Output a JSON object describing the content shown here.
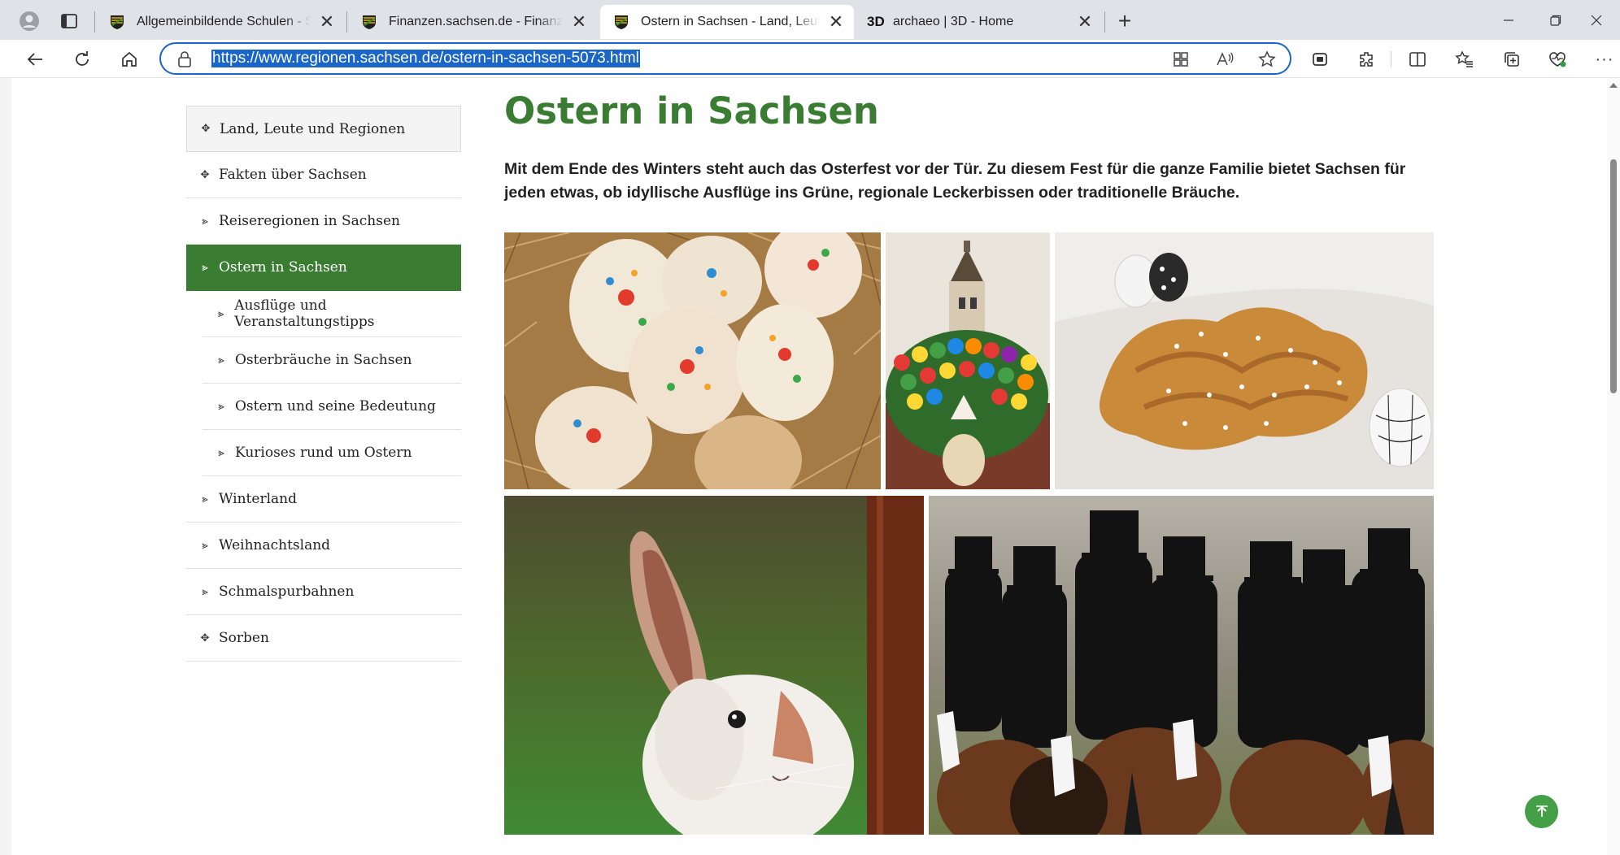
{
  "browser": {
    "tabs": [
      {
        "title": "Allgemeinbildende Schulen - Schulen in Sachsen",
        "favicon": "saxony-coat-of-arms-icon",
        "active": false
      },
      {
        "title": "Finanzen.sachsen.de - Finanzen - sachsen.de",
        "favicon": "saxony-coat-of-arms-icon",
        "active": false
      },
      {
        "title": "Ostern in Sachsen - Land, Leute und Regionen",
        "favicon": "saxony-coat-of-arms-icon",
        "active": true
      },
      {
        "title": "archaeo | 3D - Home",
        "favicon_text": "3D",
        "active": false
      }
    ],
    "url": "https://www.regionen.sachsen.de/ostern-in-sachsen-5073.html"
  },
  "sidenav": {
    "items": [
      {
        "label": "Land, Leute und Regionen",
        "marker": "✥",
        "level": 0,
        "state": "top"
      },
      {
        "label": "Fakten über Sachsen",
        "marker": "✥",
        "level": 0,
        "state": ""
      },
      {
        "label": "Reiseregionen in Sachsen",
        "marker": "⪢",
        "level": 0,
        "state": ""
      },
      {
        "label": "Ostern in Sachsen",
        "marker": "⪢",
        "level": 0,
        "state": "active"
      },
      {
        "label": "Ausflüge und Veranstaltungstipps",
        "marker": "⪢",
        "level": 1,
        "state": ""
      },
      {
        "label": "Osterbräuche in Sachsen",
        "marker": "⪢",
        "level": 1,
        "state": ""
      },
      {
        "label": "Ostern und seine Bedeutung",
        "marker": "⪢",
        "level": 1,
        "state": ""
      },
      {
        "label": "Kurioses rund um Ostern",
        "marker": "⪢",
        "level": 1,
        "state": ""
      },
      {
        "label": "Winterland",
        "marker": "⪢",
        "level": 0,
        "state": ""
      },
      {
        "label": "Weihnachtsland",
        "marker": "⪢",
        "level": 0,
        "state": ""
      },
      {
        "label": "Schmalspurbahnen",
        "marker": "⪢",
        "level": 0,
        "state": ""
      },
      {
        "label": "Sorben",
        "marker": "✥",
        "level": 0,
        "state": ""
      }
    ]
  },
  "main": {
    "title": "Ostern in Sachsen",
    "intro": "Mit dem Ende des Winters steht auch das Osterfest vor der Tür. Zu diesem Fest für die ganze Familie bietet Sachsen für jeden etwas, ob idyllische Ausflüge ins Grüne, regionale Leckerbissen oder traditionelle Bräuche."
  },
  "colors": {
    "accent": "#3a7d32",
    "url_highlight": "#1a66c8",
    "back_to_top": "#43a047"
  }
}
